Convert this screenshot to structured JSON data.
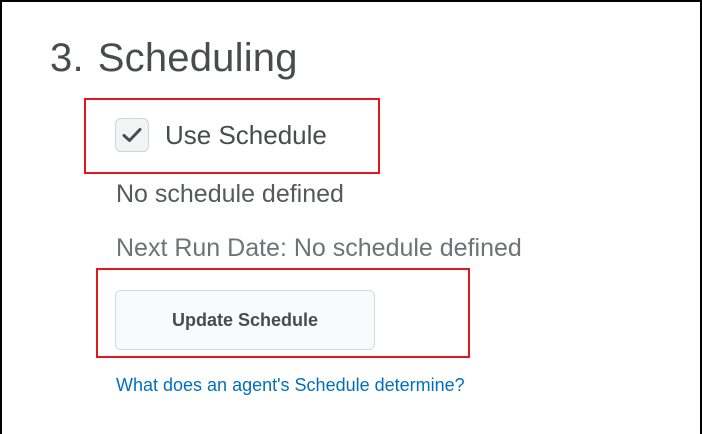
{
  "section": {
    "number": "3.",
    "title": "Scheduling"
  },
  "use_schedule": {
    "label": "Use Schedule",
    "checked": true
  },
  "schedule_status": "No schedule defined",
  "next_run": "Next Run Date: No schedule defined",
  "update_button": {
    "label": "Update Schedule"
  },
  "help_link": {
    "text": "What does an agent's Schedule determine?"
  },
  "colors": {
    "highlight": "#e0191f",
    "link": "#006fbf",
    "text": "#494c4e"
  },
  "icons": {
    "checkbox": "checkmark-icon"
  }
}
